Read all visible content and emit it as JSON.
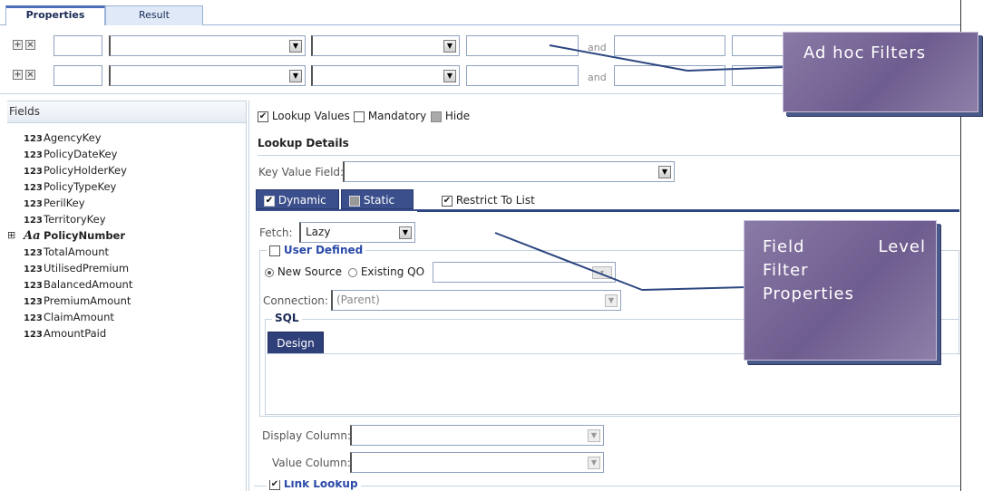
{
  "tabs": {
    "properties": "Properties",
    "result": "Result"
  },
  "filters": {
    "and_label": "and"
  },
  "fields_panel": {
    "title": "Fields",
    "items": [
      {
        "type": "123",
        "name": "AgencyKey"
      },
      {
        "type": "123",
        "name": "PolicyDateKey"
      },
      {
        "type": "123",
        "name": "PolicyHolderKey"
      },
      {
        "type": "123",
        "name": "PolicyTypeKey"
      },
      {
        "type": "123",
        "name": "PerilKey"
      },
      {
        "type": "123",
        "name": "TerritoryKey"
      },
      {
        "type": "Aa",
        "name": "PolicyNumber"
      },
      {
        "type": "123",
        "name": "TotalAmount"
      },
      {
        "type": "123",
        "name": "UtilisedPremium"
      },
      {
        "type": "123",
        "name": "BalancedAmount"
      },
      {
        "type": "123",
        "name": "PremiumAmount"
      },
      {
        "type": "123",
        "name": "ClaimAmount"
      },
      {
        "type": "123",
        "name": "AmountPaid"
      }
    ]
  },
  "properties": {
    "lookup_values": "Lookup Values",
    "mandatory": "Mandatory",
    "hide": "Hide",
    "lookup_details": "Lookup Details",
    "key_value_field": "Key Value Field:",
    "dynamic": "Dynamic",
    "static": "Static",
    "restrict_to_list": "Restrict To List",
    "fetch_label": "Fetch:",
    "fetch_value": "Lazy",
    "user_defined": "User Defined",
    "new_source": "New Source",
    "existing_qo": "Existing QO",
    "connection_label": "Connection:",
    "connection_value": "(Parent)",
    "sql_label": "SQL",
    "design_button": "Design",
    "display_column": "Display Column:",
    "value_column": "Value Column:",
    "link_lookup": "Link Lookup"
  },
  "callouts": {
    "ad_hoc": "Ad hoc Filters",
    "field_level": [
      "Field Level",
      "Filter",
      "Properties"
    ]
  },
  "colors": {
    "callout_bg": "#7a6a98",
    "callout_shadow": "#4a5a88",
    "segment_blue": "#3b4f8c",
    "accent_blue": "#2a4aa8"
  }
}
